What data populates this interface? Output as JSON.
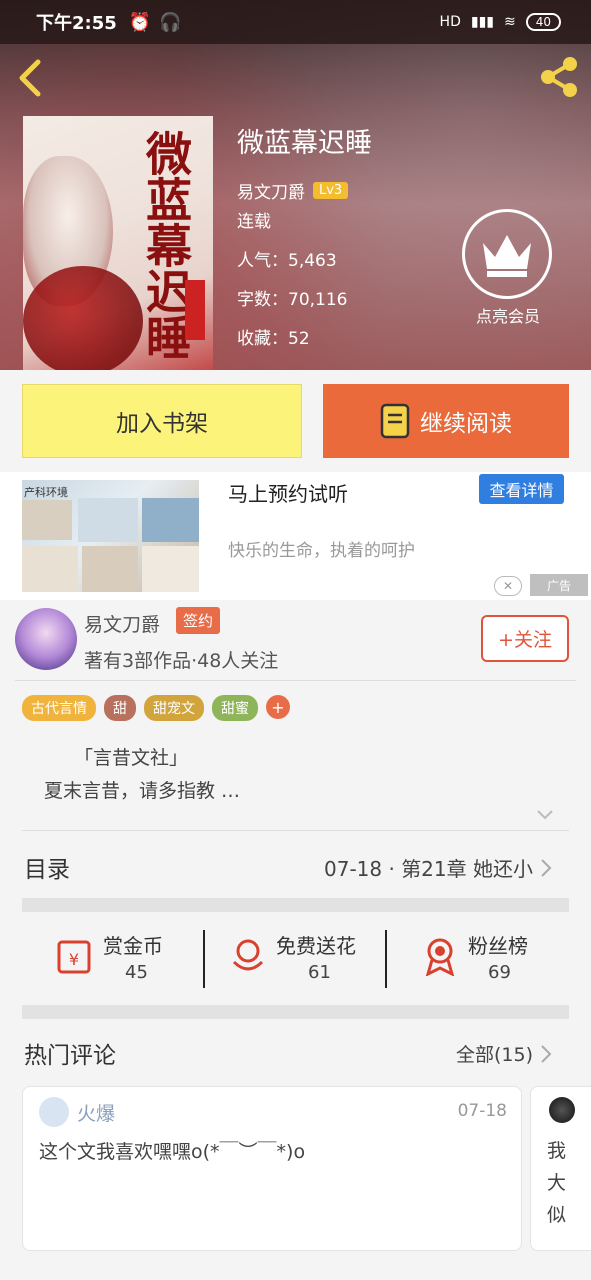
{
  "status_bar": {
    "time": "下午2:55",
    "network": "HD",
    "battery": "40"
  },
  "book": {
    "title": "微蓝幕迟睡",
    "author": "易文刀爵",
    "author_level": "Lv3",
    "status": "连载",
    "popularity": "人气：5,463",
    "word_count": "字数：70,116",
    "favorites": "收藏：52",
    "cover_title": "微蓝幕迟睡"
  },
  "vip": {
    "label": "点亮会员",
    "icon": "crown-icon"
  },
  "actions": {
    "add_shelf": "加入书架",
    "continue_reading": "继续阅读"
  },
  "ad": {
    "image_caption": "产科环境",
    "title": "马上预约试听",
    "description": "快乐的生命，执着的呵护",
    "detail_button": "查看详情",
    "close": "✕",
    "badge": "广告"
  },
  "author": {
    "name": "易文刀爵",
    "sign_badge": "签约",
    "stats": "著有3部作品·48人关注",
    "follow_button": "+关注"
  },
  "tags": [
    {
      "label": "古代言情",
      "color": "#f0b43c"
    },
    {
      "label": "甜",
      "color": "#b9705c"
    },
    {
      "label": "甜宠文",
      "color": "#d2a43c"
    },
    {
      "label": "甜蜜",
      "color": "#8fb55a"
    }
  ],
  "tag_more": "+",
  "description": {
    "line1": "「言昔文社」",
    "line2": "夏末言昔，请多指教 …"
  },
  "catalog": {
    "label": "目录",
    "latest": "07-18 · 第21章 她还小"
  },
  "stats": [
    {
      "label": "赏金币",
      "value": "45",
      "icon": "red-envelope-icon"
    },
    {
      "label": "免费送花",
      "value": "61",
      "icon": "flower-icon"
    },
    {
      "label": "粉丝榜",
      "value": "69",
      "icon": "medal-icon"
    }
  ],
  "comments": {
    "label": "热门评论",
    "all": "全部(15)",
    "items": [
      {
        "tag": "火爆",
        "date": "07-18",
        "text": "这个文我喜欢嘿嘿o(*￣︶￣*)o"
      },
      {
        "text_lines": [
          "我",
          "大",
          "似"
        ]
      }
    ]
  },
  "colors": {
    "accent_orange": "#eb6a3c",
    "shelf_yellow": "#fcf47a",
    "ad_blue": "#2f7ee0"
  }
}
